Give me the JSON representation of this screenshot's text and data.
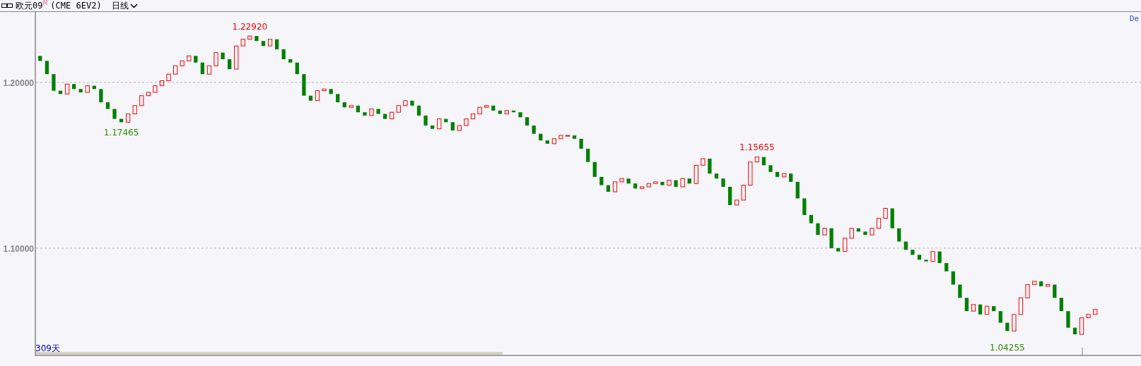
{
  "header": {
    "name": "欧元09",
    "badge": "M",
    "code": "(CME 6EV2)",
    "period": "日线"
  },
  "corner_label": "De",
  "bar_count": "309天",
  "price_axis_labels": [
    "1.20000",
    "1.10000"
  ],
  "price_labels": [
    {
      "text": "1.22920",
      "kind": "high"
    },
    {
      "text": "1.17465",
      "kind": "low"
    },
    {
      "text": "1.15655",
      "kind": "high"
    },
    {
      "text": "1.04255",
      "kind": "low"
    }
  ]
}
